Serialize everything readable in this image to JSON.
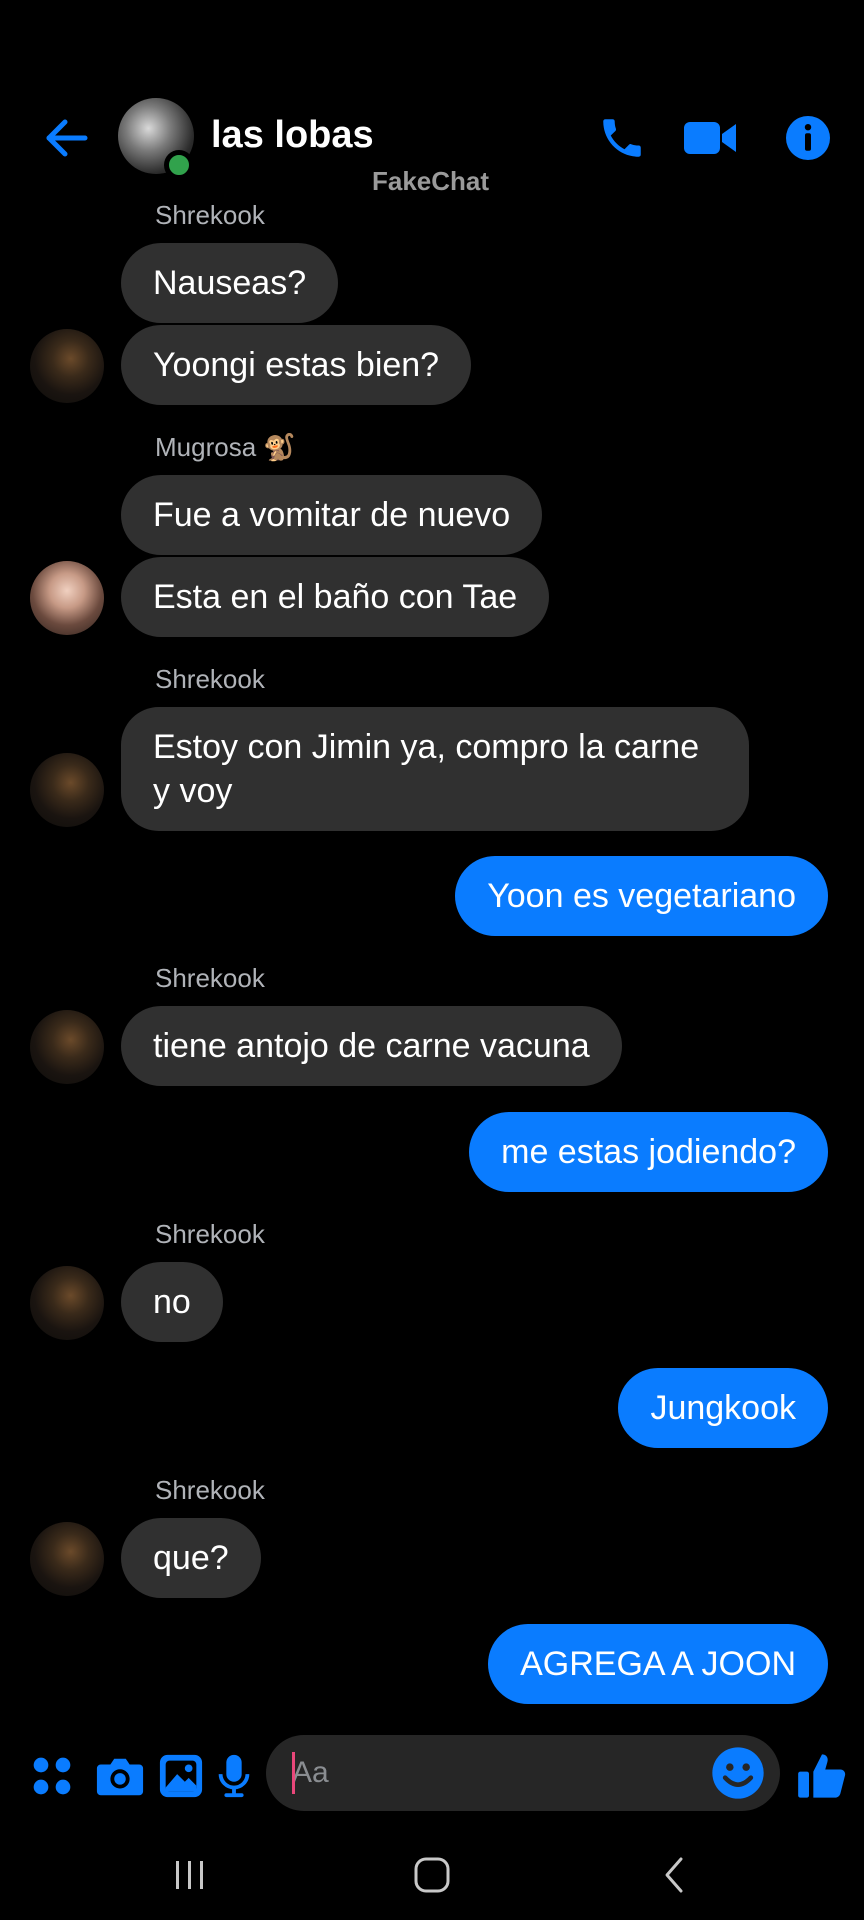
{
  "header": {
    "title": "las lobas",
    "watermark": "FakeChat"
  },
  "colors": {
    "accent": "#0a7cff",
    "incoming_bubble": "#303030",
    "online": "#31a24c",
    "sender_name": "#b0b3b8"
  },
  "icons": [
    "back-arrow-icon",
    "phone-icon",
    "video-camera-icon",
    "info-icon",
    "apps-grid-icon",
    "camera-icon",
    "gallery-icon",
    "microphone-icon",
    "emoji-icon",
    "thumbs-up-icon"
  ],
  "messages": [
    {
      "sender": "Shrekook"
    },
    {
      "text": "Nauseas?"
    },
    {
      "text": "Yoongi estas bien?"
    },
    {
      "sender": "Mugrosa 🐒"
    },
    {
      "text": "Fue a vomitar de nuevo"
    },
    {
      "text": "Esta en el baño con Tae"
    },
    {
      "sender": "Shrekook"
    },
    {
      "text": "Estoy con Jimin ya, compro la carne y voy"
    },
    {
      "text": "Yoon es vegetariano"
    },
    {
      "sender": "Shrekook"
    },
    {
      "text": "tiene antojo de carne vacuna"
    },
    {
      "text": "me estas jodiendo?"
    },
    {
      "sender": "Shrekook"
    },
    {
      "text": "no"
    },
    {
      "text": "Jungkook"
    },
    {
      "sender": "Shrekook"
    },
    {
      "text": "que?"
    },
    {
      "text": "AGREGA A JOON"
    }
  ],
  "composer": {
    "placeholder": "Aa"
  }
}
